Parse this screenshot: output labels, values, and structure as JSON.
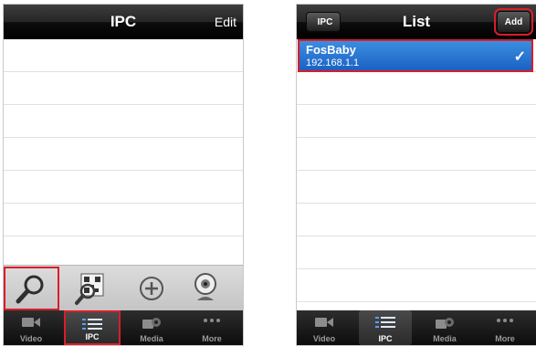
{
  "left_screen": {
    "title": "IPC",
    "edit_label": "Edit",
    "row_count": 7,
    "toolbar": {
      "icons": [
        "search-icon",
        "qr-scan-icon",
        "add-icon",
        "webcam-icon"
      ]
    },
    "tabs": [
      {
        "label": "Video",
        "icon": "video-camera-icon"
      },
      {
        "label": "IPC",
        "icon": "list-icon"
      },
      {
        "label": "Media",
        "icon": "media-icon"
      },
      {
        "label": "More",
        "icon": "more-icon"
      }
    ],
    "active_tab": "IPC"
  },
  "right_screen": {
    "back_label": "IPC",
    "title": "List",
    "add_label": "Add",
    "selected_device": {
      "name": "FosBaby",
      "ip": "192.168.1.1",
      "check": "✓"
    },
    "tabs": [
      {
        "label": "Video",
        "icon": "video-camera-icon"
      },
      {
        "label": "IPC",
        "icon": "list-icon"
      },
      {
        "label": "Media",
        "icon": "media-icon"
      },
      {
        "label": "More",
        "icon": "more-icon"
      }
    ],
    "active_tab": "IPC"
  },
  "colors": {
    "highlight_box": "#d81e2a",
    "selection_blue": "#2a75d6",
    "navbar_black": "#111111"
  }
}
